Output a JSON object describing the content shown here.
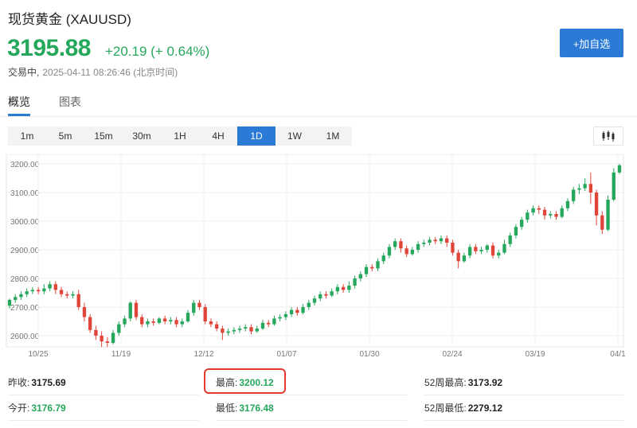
{
  "header": {
    "title": "现货黄金 (XAUUSD)",
    "price": "3195.88",
    "change": "+20.19 (+ 0.64%)",
    "status": "交易中,",
    "timestamp": "2025-04-11 08:26:46 (北京时间)",
    "add_watchlist": "+加自选"
  },
  "tabs": [
    {
      "label": "概览",
      "active": true
    },
    {
      "label": "图表",
      "active": false
    }
  ],
  "periods": [
    {
      "label": "1m",
      "active": false
    },
    {
      "label": "5m",
      "active": false
    },
    {
      "label": "15m",
      "active": false
    },
    {
      "label": "30m",
      "active": false
    },
    {
      "label": "1H",
      "active": false
    },
    {
      "label": "4H",
      "active": false
    },
    {
      "label": "1D",
      "active": true
    },
    {
      "label": "1W",
      "active": false
    },
    {
      "label": "1M",
      "active": false
    }
  ],
  "colors": {
    "up": "#26a85c",
    "down": "#e0453a",
    "accent": "#2a7ad6",
    "highlight": "#e23b2e"
  },
  "icons": {
    "candle_toggle": "candlestick-icon"
  },
  "stats": {
    "prev_close_label": "昨收:",
    "prev_close": "3175.69",
    "open_label": "今开:",
    "open": "3176.79",
    "high_label": "最高:",
    "high": "3200.12",
    "low_label": "最低:",
    "low": "3176.48",
    "w52_high_label": "52周最高:",
    "w52_high": "3173.92",
    "w52_low_label": "52周最低:",
    "w52_low": "2279.12"
  },
  "chart_data": {
    "type": "candlestick",
    "ylim": [
      2560,
      3220
    ],
    "y_ticks": [
      "3200.00",
      "3100.00",
      "3000.00",
      "2900.00",
      "2800.00",
      "2700.00",
      "2600.00"
    ],
    "x_ticks": [
      "10/25",
      "11/19",
      "12/12",
      "01/07",
      "01/30",
      "02/24",
      "03/19",
      "04/1"
    ],
    "grid": true,
    "candles": [
      [
        2705,
        2725,
        2695,
        2730
      ],
      [
        2725,
        2735,
        2715,
        2745
      ],
      [
        2735,
        2745,
        2725,
        2755
      ],
      [
        2745,
        2755,
        2735,
        2765
      ],
      [
        2755,
        2760,
        2745,
        2770
      ],
      [
        2760,
        2755,
        2745,
        2770
      ],
      [
        2755,
        2765,
        2745,
        2780
      ],
      [
        2765,
        2780,
        2755,
        2790
      ],
      [
        2780,
        2760,
        2745,
        2790
      ],
      [
        2760,
        2745,
        2735,
        2770
      ],
      [
        2745,
        2740,
        2730,
        2755
      ],
      [
        2740,
        2745,
        2730,
        2755
      ],
      [
        2745,
        2700,
        2690,
        2760
      ],
      [
        2700,
        2665,
        2650,
        2715
      ],
      [
        2665,
        2620,
        2610,
        2675
      ],
      [
        2620,
        2600,
        2585,
        2635
      ],
      [
        2600,
        2580,
        2560,
        2615
      ],
      [
        2580,
        2575,
        2560,
        2595
      ],
      [
        2575,
        2610,
        2570,
        2620
      ],
      [
        2610,
        2640,
        2600,
        2650
      ],
      [
        2640,
        2660,
        2630,
        2670
      ],
      [
        2660,
        2715,
        2650,
        2720
      ],
      [
        2715,
        2665,
        2655,
        2725
      ],
      [
        2665,
        2640,
        2630,
        2675
      ],
      [
        2640,
        2650,
        2630,
        2660
      ],
      [
        2650,
        2645,
        2635,
        2660
      ],
      [
        2645,
        2660,
        2640,
        2665
      ],
      [
        2660,
        2650,
        2640,
        2670
      ],
      [
        2650,
        2655,
        2640,
        2665
      ],
      [
        2655,
        2640,
        2630,
        2665
      ],
      [
        2640,
        2650,
        2630,
        2660
      ],
      [
        2650,
        2680,
        2645,
        2690
      ],
      [
        2680,
        2715,
        2670,
        2725
      ],
      [
        2715,
        2700,
        2690,
        2725
      ],
      [
        2700,
        2650,
        2640,
        2710
      ],
      [
        2650,
        2640,
        2630,
        2660
      ],
      [
        2640,
        2625,
        2615,
        2650
      ],
      [
        2625,
        2610,
        2585,
        2635
      ],
      [
        2610,
        2615,
        2600,
        2625
      ],
      [
        2615,
        2620,
        2605,
        2630
      ],
      [
        2620,
        2625,
        2610,
        2635
      ],
      [
        2625,
        2630,
        2615,
        2640
      ],
      [
        2630,
        2615,
        2605,
        2640
      ],
      [
        2615,
        2625,
        2610,
        2635
      ],
      [
        2625,
        2645,
        2620,
        2655
      ],
      [
        2645,
        2640,
        2630,
        2655
      ],
      [
        2640,
        2660,
        2635,
        2670
      ],
      [
        2660,
        2665,
        2650,
        2675
      ],
      [
        2665,
        2675,
        2655,
        2685
      ],
      [
        2675,
        2690,
        2665,
        2700
      ],
      [
        2690,
        2680,
        2670,
        2700
      ],
      [
        2680,
        2700,
        2675,
        2710
      ],
      [
        2700,
        2715,
        2690,
        2725
      ],
      [
        2715,
        2730,
        2705,
        2740
      ],
      [
        2730,
        2745,
        2720,
        2755
      ],
      [
        2745,
        2740,
        2730,
        2755
      ],
      [
        2740,
        2755,
        2735,
        2765
      ],
      [
        2755,
        2770,
        2745,
        2780
      ],
      [
        2770,
        2760,
        2750,
        2780
      ],
      [
        2760,
        2775,
        2750,
        2790
      ],
      [
        2775,
        2800,
        2765,
        2810
      ],
      [
        2800,
        2815,
        2790,
        2825
      ],
      [
        2815,
        2840,
        2805,
        2850
      ],
      [
        2840,
        2835,
        2825,
        2850
      ],
      [
        2835,
        2860,
        2825,
        2870
      ],
      [
        2860,
        2880,
        2850,
        2890
      ],
      [
        2880,
        2910,
        2870,
        2920
      ],
      [
        2910,
        2930,
        2900,
        2940
      ],
      [
        2930,
        2905,
        2890,
        2940
      ],
      [
        2905,
        2885,
        2875,
        2915
      ],
      [
        2885,
        2900,
        2880,
        2910
      ],
      [
        2900,
        2920,
        2890,
        2930
      ],
      [
        2920,
        2925,
        2910,
        2935
      ],
      [
        2925,
        2935,
        2915,
        2945
      ],
      [
        2935,
        2930,
        2920,
        2945
      ],
      [
        2930,
        2940,
        2920,
        2950
      ],
      [
        2940,
        2925,
        2910,
        2950
      ],
      [
        2925,
        2890,
        2880,
        2935
      ],
      [
        2890,
        2860,
        2835,
        2900
      ],
      [
        2860,
        2880,
        2855,
        2890
      ],
      [
        2880,
        2910,
        2870,
        2920
      ],
      [
        2910,
        2895,
        2885,
        2920
      ],
      [
        2895,
        2900,
        2885,
        2910
      ],
      [
        2900,
        2915,
        2890,
        2920
      ],
      [
        2915,
        2880,
        2870,
        2925
      ],
      [
        2880,
        2890,
        2870,
        2900
      ],
      [
        2890,
        2920,
        2885,
        2935
      ],
      [
        2920,
        2950,
        2910,
        2960
      ],
      [
        2950,
        2980,
        2940,
        2990
      ],
      [
        2980,
        3005,
        2970,
        3015
      ],
      [
        3005,
        3030,
        2995,
        3040
      ],
      [
        3030,
        3045,
        3020,
        3055
      ],
      [
        3045,
        3040,
        3025,
        3055
      ],
      [
        3040,
        3020,
        3005,
        3050
      ],
      [
        3020,
        3025,
        3010,
        3035
      ],
      [
        3025,
        3015,
        3005,
        3035
      ],
      [
        3015,
        3045,
        3010,
        3055
      ],
      [
        3045,
        3070,
        3035,
        3080
      ],
      [
        3070,
        3110,
        3060,
        3120
      ],
      [
        3110,
        3115,
        3095,
        3130
      ],
      [
        3115,
        3130,
        3105,
        3150
      ],
      [
        3130,
        3100,
        3060,
        3170
      ],
      [
        3100,
        3020,
        2985,
        3110
      ],
      [
        3020,
        2970,
        2955,
        3035
      ],
      [
        2970,
        3075,
        2965,
        3090
      ],
      [
        3075,
        3170,
        3070,
        3185
      ],
      [
        3170,
        3195,
        3165,
        3200
      ]
    ]
  }
}
